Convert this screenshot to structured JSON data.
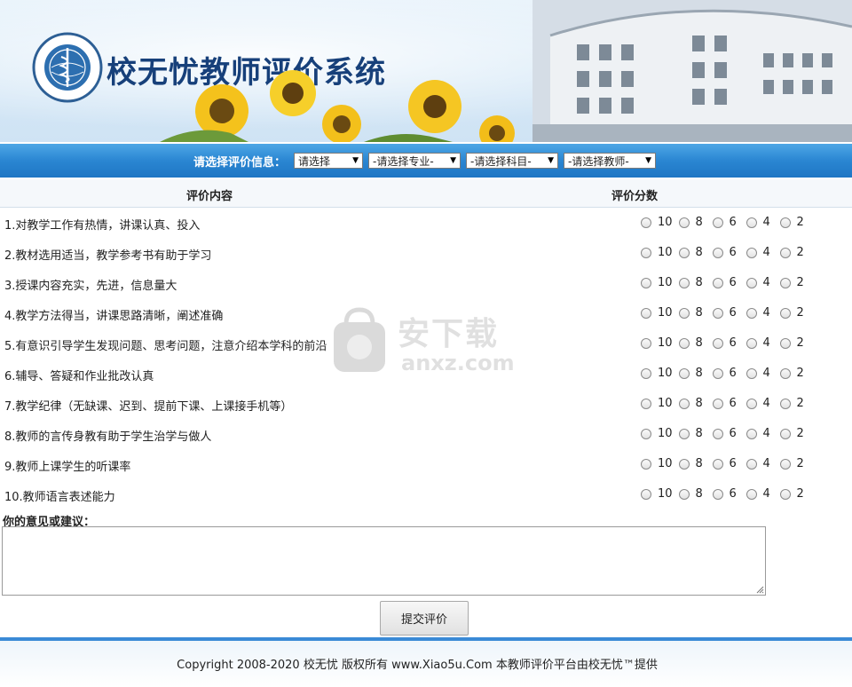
{
  "header": {
    "title": "校无忧教师评价系统",
    "logo_icon": "college-seal-logo"
  },
  "filters": {
    "label": "请选择评价信息：",
    "selects": [
      {
        "name": "class",
        "value": "请选择"
      },
      {
        "name": "major",
        "value": "-请选择专业-"
      },
      {
        "name": "subject",
        "value": "-请选择科目-"
      },
      {
        "name": "teacher",
        "value": "-请选择教师-"
      }
    ]
  },
  "table": {
    "col_content": "评价内容",
    "col_score": "评价分数",
    "score_options": [
      "10",
      "8",
      "6",
      "4",
      "2"
    ],
    "items": [
      "1.对教学工作有热情，讲课认真、投入",
      "2.教材选用适当，教学参考书有助于学习",
      "3.授课内容充实，先进，信息量大",
      "4.教学方法得当，讲课思路清晰，阐述准确",
      "5.有意识引导学生发现问题、思考问题，注意介绍本学科的前沿",
      "6.辅导、答疑和作业批改认真",
      "7.教学纪律（无缺课、迟到、提前下课、上课接手机等）",
      "8.教师的言传身教有助于学生治学与做人",
      "9.教师上课学生的听课率",
      "10.教师语言表述能力"
    ]
  },
  "suggestion": {
    "label": "你的意见或建议：",
    "value": ""
  },
  "submit_label": "提交评价",
  "footer": {
    "text": "Copyright 2008-2020 校无忧 版权所有 www.Xiao5u.Com 本教师评价平台由校无忧™提供"
  },
  "watermark": {
    "text": "安下载",
    "sub": "anxz.com"
  },
  "colors": {
    "bar_blue": "#2a86d2",
    "title_blue": "#17407a"
  }
}
